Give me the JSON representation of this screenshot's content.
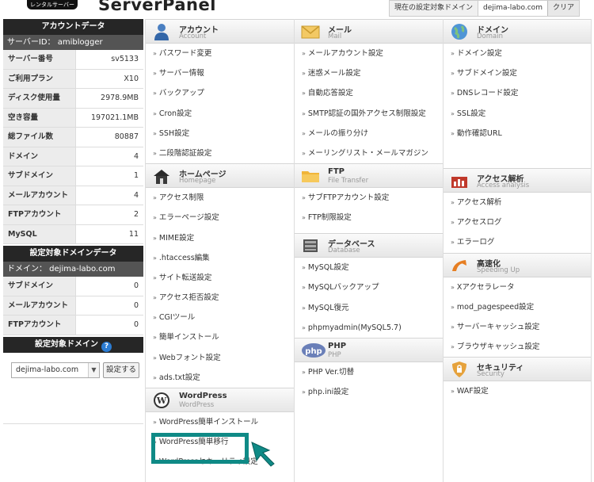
{
  "header": {
    "logo_badge": "レンタルサーバー",
    "logo_name": "ServerPanel",
    "current_domain_label": "現在の設定対象ドメイン",
    "current_domain_value": "dejima-labo.com",
    "clear_label": "クリア"
  },
  "sidebar": {
    "server_title": "アカウントデータ",
    "server_id": "サーバーID： amiblogger",
    "rows": [
      {
        "k": "サーバー番号",
        "v": "sv5133"
      },
      {
        "k": "ご利用プラン",
        "v": "X10"
      },
      {
        "k": "ディスク使用量",
        "v": "2978.9MB"
      },
      {
        "k": "空き容量",
        "v": "197021.1MB"
      },
      {
        "k": "総ファイル数",
        "v": "80887"
      },
      {
        "k": "ドメイン",
        "v": "4"
      },
      {
        "k": "サブドメイン",
        "v": "1"
      },
      {
        "k": "メールアカウント",
        "v": "4"
      },
      {
        "k": "FTPアカウント",
        "v": "2"
      },
      {
        "k": "MySQL",
        "v": "11"
      }
    ],
    "domain_title": "設定対象ドメインデータ",
    "domain_sub": "ドメイン： dejima-labo.com",
    "domain_rows": [
      {
        "k": "サブドメイン",
        "v": "0"
      },
      {
        "k": "メールアカウント",
        "v": "0"
      },
      {
        "k": "FTPアカウント",
        "v": "0"
      }
    ],
    "select_title": "設定対象ドメイン",
    "help": "?",
    "select_value": "dejima-labo.com",
    "set_button": "設定する"
  },
  "sections": {
    "account": {
      "title": "アカウント",
      "sub": "Account",
      "items": [
        "パスワード変更",
        "サーバー情報",
        "バックアップ",
        "Cron設定",
        "SSH設定",
        "二段階認証設定"
      ]
    },
    "homepage": {
      "title": "ホームページ",
      "sub": "Homepage",
      "items": [
        "アクセス制限",
        "エラーページ設定",
        "MIME設定",
        ".htaccess編集",
        "サイト転送設定",
        "アクセス拒否設定",
        "CGIツール",
        "簡単インストール",
        "Webフォント設定",
        "ads.txt設定"
      ]
    },
    "wordpress": {
      "title": "WordPress",
      "sub": "WordPress",
      "items": [
        "WordPress簡単インストール",
        "WordPress簡単移行",
        "WordPressセキュリティ設定"
      ]
    },
    "mail": {
      "title": "メール",
      "sub": "Mail",
      "items": [
        "メールアカウント設定",
        "迷惑メール設定",
        "自動応答設定",
        "SMTP認証の国外アクセス制限設定",
        "メールの振り分け",
        "メーリングリスト・メールマガジン"
      ]
    },
    "ftp": {
      "title": "FTP",
      "sub": "File Transfer",
      "items": [
        "サブFTPアカウント設定",
        "FTP制限設定"
      ]
    },
    "database": {
      "title": "データベース",
      "sub": "Database",
      "items": [
        "MySQL設定",
        "MySQLバックアップ",
        "MySQL復元",
        "phpmyadmin(MySQL5.7)"
      ]
    },
    "php": {
      "title": "PHP",
      "sub": "PHP",
      "items": [
        "PHP Ver.切替",
        "php.ini設定"
      ]
    },
    "domain": {
      "title": "ドメイン",
      "sub": "Domain",
      "items": [
        "ドメイン設定",
        "サブドメイン設定",
        "DNSレコード設定",
        "SSL設定",
        "動作確認URL"
      ]
    },
    "analytics": {
      "title": "アクセス解析",
      "sub": "Access analysis",
      "items": [
        "アクセス解析",
        "アクセスログ",
        "エラーログ"
      ]
    },
    "speed": {
      "title": "高速化",
      "sub": "Speeding Up",
      "items": [
        "Xアクセラレータ",
        "mod_pagespeed設定",
        "サーバーキャッシュ設定",
        "ブラウザキャッシュ設定"
      ]
    },
    "security": {
      "title": "セキュリティ",
      "sub": "Security",
      "items": [
        "WAF設定"
      ]
    }
  },
  "colors": {
    "highlight": "#0f8a86",
    "sidebar_dark": "#262626",
    "sidebar_sub": "#545454"
  }
}
